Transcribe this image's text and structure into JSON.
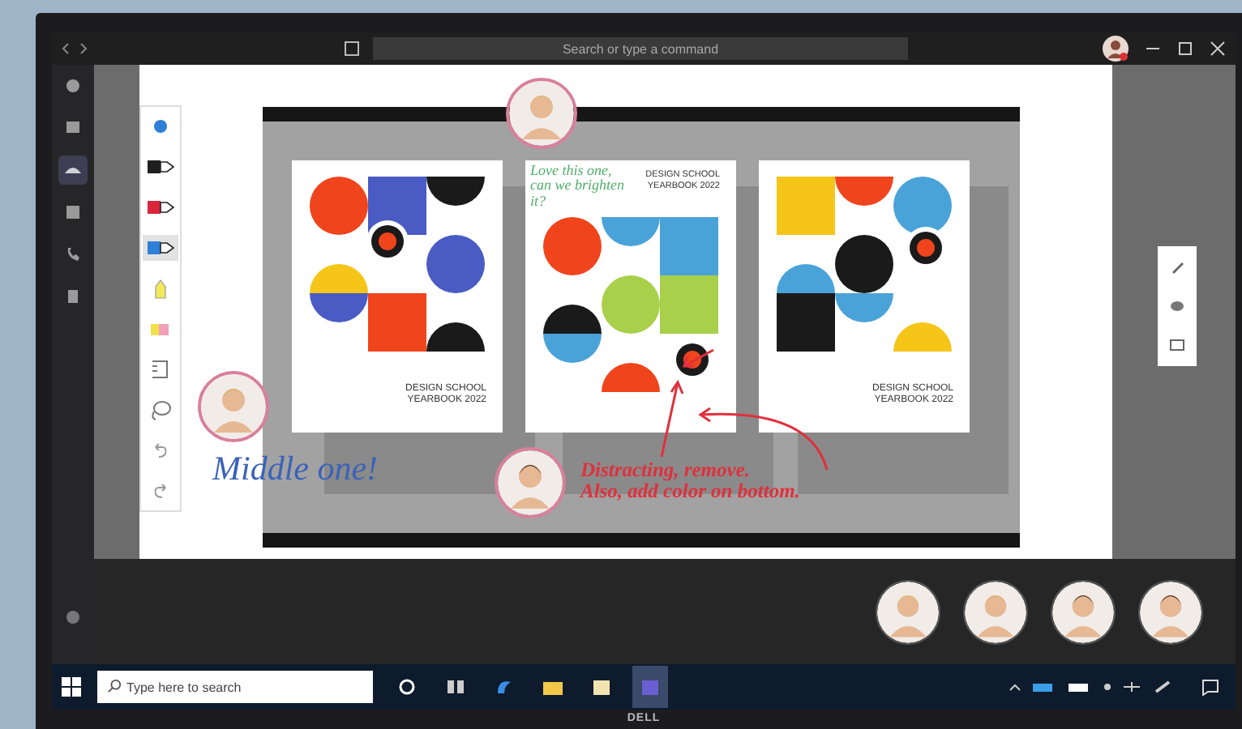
{
  "titlebar": {
    "search_placeholder": "Search or type a command"
  },
  "rail": [
    {
      "selected": false
    },
    {
      "selected": false
    },
    {
      "selected": true
    },
    {
      "selected": false
    },
    {
      "selected": false
    },
    {
      "selected": false
    }
  ],
  "pen_tools": [
    {
      "kind": "dot",
      "color": "#2f7fd8",
      "selected": false
    },
    {
      "kind": "pen",
      "color": "#1f1f1f",
      "selected": false
    },
    {
      "kind": "pen",
      "color": "#d8263a",
      "selected": false
    },
    {
      "kind": "pen",
      "color": "#2f7fd8",
      "selected": true
    },
    {
      "kind": "highlighter",
      "color": "#f2e85a",
      "selected": false
    },
    {
      "kind": "eraser",
      "color": "#f0a0b8",
      "selected": false
    },
    {
      "kind": "ruler",
      "selected": false
    },
    {
      "kind": "lasso",
      "selected": false
    },
    {
      "kind": "undo",
      "selected": false
    },
    {
      "kind": "redo",
      "selected": false
    }
  ],
  "posters": [
    {
      "caption": "DESIGN SCHOOL\nYEARBOOK 2022",
      "kind": "classic"
    },
    {
      "caption": "DESIGN SCHOOL\nYEARBOOK 2022",
      "kind": "flipped"
    },
    {
      "caption": "DESIGN SCHOOL\nYEARBOOK 2022",
      "kind": "classic"
    }
  ],
  "annotations": [
    {
      "text": "Love this one,\ncan we brighten\nit?",
      "color": "#4fae6a"
    },
    {
      "text": "Middle one!",
      "color": "#3a62b8"
    },
    {
      "text": "Distracting, remove.\nAlso, add color on bottom.",
      "color": "#e0303c"
    }
  ],
  "participants": [
    {
      "kind": "avatar"
    },
    {
      "kind": "avatar"
    },
    {
      "kind": "avatar"
    },
    {
      "kind": "avatar"
    }
  ],
  "taskbar": {
    "search_placeholder": "Type here to search",
    "apps": [
      {
        "selected": false
      },
      {
        "selected": false
      },
      {
        "selected": false
      },
      {
        "selected": false
      },
      {
        "selected": false
      },
      {
        "selected": true
      }
    ]
  },
  "monitor": {
    "brand": "DELL"
  }
}
